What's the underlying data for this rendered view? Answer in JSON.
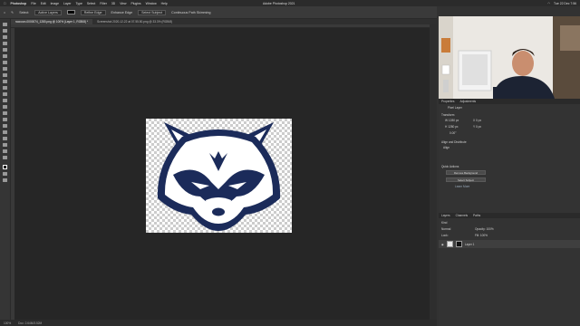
{
  "menubar": {
    "app": "Photoshop",
    "items": [
      "File",
      "Edit",
      "Image",
      "Layer",
      "Type",
      "Select",
      "Filter",
      "3D",
      "View",
      "Plugins",
      "Window",
      "Help"
    ],
    "clock": "Tue 22 Dec  7:56"
  },
  "window_title": "Adobe Photoshop 2021",
  "options": {
    "select_label": "Select:",
    "select_value": "Active Layers",
    "refine": "Refine Edge",
    "enhance": "Enhance Edge",
    "select_subject": "Select Subject",
    "continuous": "Continuous Path Skimming"
  },
  "tabs": [
    {
      "label": "raccoon-0000074_1280.png @ 100% (Layer 1, RGB/8) *"
    },
    {
      "label": "Screenshot 2020-12-22 at 07.55.50.png @ 33.3% (RGB/8)"
    }
  ],
  "status": {
    "zoom": "100%",
    "doc": "Doc: 2.64M/3.52M"
  },
  "properties": {
    "tabs": [
      "Properties",
      "Adjustments"
    ],
    "pixel_layer": "Pixel Layer",
    "transform": "Transform",
    "w": "W 1280 px",
    "h": "H 1280 px",
    "x": "X 0 px",
    "y": "Y 0 px",
    "angle": "0.00°",
    "align": "Align and Distribute",
    "align_sub": "Align",
    "quick": "Quick Actions",
    "remove_bg": "Remove Background",
    "select_subject": "Select Subject",
    "learn_more": "Learn More"
  },
  "layers": {
    "tabs": [
      "Layers",
      "Channels",
      "Paths"
    ],
    "kind": "Kind",
    "mode": "Normal",
    "opacity": "Opacity: 100%",
    "lock": "Lock:",
    "fill": "Fill: 100%",
    "layer_name": "Layer 1"
  },
  "colors": {
    "accent": "#1b2b5a",
    "bg": "#262626"
  }
}
